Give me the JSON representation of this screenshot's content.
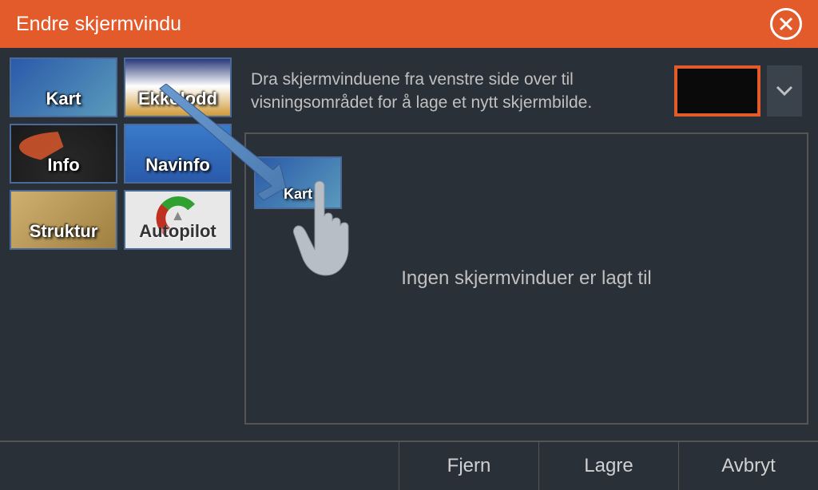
{
  "header": {
    "title": "Endre skjermvindu"
  },
  "sidebar": {
    "tiles": [
      {
        "label": "Kart",
        "class": "tile-kart"
      },
      {
        "label": "Ekkolodd",
        "class": "tile-ekkolodd"
      },
      {
        "label": "Info",
        "class": "tile-info"
      },
      {
        "label": "Navinfo",
        "class": "tile-navinfo"
      },
      {
        "label": "Struktur",
        "class": "tile-struktur"
      },
      {
        "label": "Autopilot",
        "class": "tile-autopilot"
      }
    ]
  },
  "instruction_text": "Dra skjermvinduene fra venstre side over til visningsområdet for å lage et nytt skjermbilde.",
  "dropped_tile_label": "Kart",
  "dropzone_text": "Ingen skjermvinduer er lagt til",
  "footer": {
    "remove": "Fjern",
    "save": "Lagre",
    "cancel": "Avbryt"
  },
  "colors": {
    "accent": "#e35a2b",
    "background": "#2a3038"
  }
}
